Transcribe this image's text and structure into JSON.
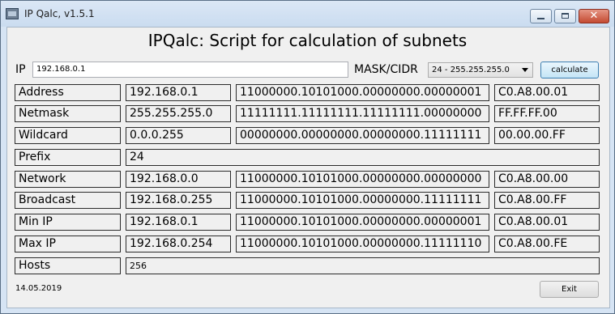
{
  "window": {
    "title": "IP Qalc, v1.5.1",
    "close_symbol": "✕",
    "app_icon": "calculator-app-icon"
  },
  "heading": "IPQalc: Script for calculation of subnets",
  "input": {
    "ip_label": "IP",
    "ip_value": "192.168.0.1",
    "mask_label": "MASK/CIDR",
    "mask_value": "24 - 255.255.255.0",
    "calculate_label": "calculate"
  },
  "rows": [
    {
      "label": "Address",
      "decimal": "192.168.0.1",
      "binary": "11000000.10101000.00000000.00000001",
      "hex": "C0.A8.00.01"
    },
    {
      "label": "Netmask",
      "decimal": "255.255.255.0",
      "binary": "11111111.11111111.11111111.00000000",
      "hex": "FF.FF.FF.00"
    },
    {
      "label": "Wildcard",
      "decimal": "0.0.0.255",
      "binary": "00000000.00000000.00000000.11111111",
      "hex": "00.00.00.FF"
    },
    {
      "label": "Network",
      "decimal": "192.168.0.0",
      "binary": "11000000.10101000.00000000.00000000",
      "hex": "C0.A8.00.00"
    },
    {
      "label": "Broadcast",
      "decimal": "192.168.0.255",
      "binary": "11000000.10101000.00000000.11111111",
      "hex": "C0.A8.00.FF"
    },
    {
      "label": "Min IP",
      "decimal": "192.168.0.1",
      "binary": "11000000.10101000.00000000.00000001",
      "hex": "C0.A8.00.01"
    },
    {
      "label": "Max IP",
      "decimal": "192.168.0.254",
      "binary": "11000000.10101000.00000000.11111110",
      "hex": "C0.A8.00.FE"
    }
  ],
  "prefix": {
    "label": "Prefix",
    "value": "24"
  },
  "hosts": {
    "label": "Hosts",
    "value": "256"
  },
  "footer": {
    "date": "14.05.2019",
    "exit_label": "Exit"
  }
}
